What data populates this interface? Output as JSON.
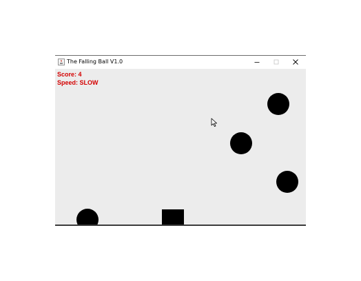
{
  "window": {
    "title": "The Falling Ball V1.0"
  },
  "hud": {
    "score_label": "Score: ",
    "score_value": "4",
    "speed_label": "Speed: ",
    "speed_value": "SLOW",
    "text_color": "#d40000"
  },
  "icons": {
    "app": "java-cup-icon",
    "minimize": "minimize-icon",
    "maximize": "maximize-icon",
    "close": "close-icon",
    "cursor": "mouse-pointer-icon"
  },
  "game": {
    "background_color": "#ececec",
    "ball_color": "#000000",
    "paddle_color": "#000000"
  }
}
